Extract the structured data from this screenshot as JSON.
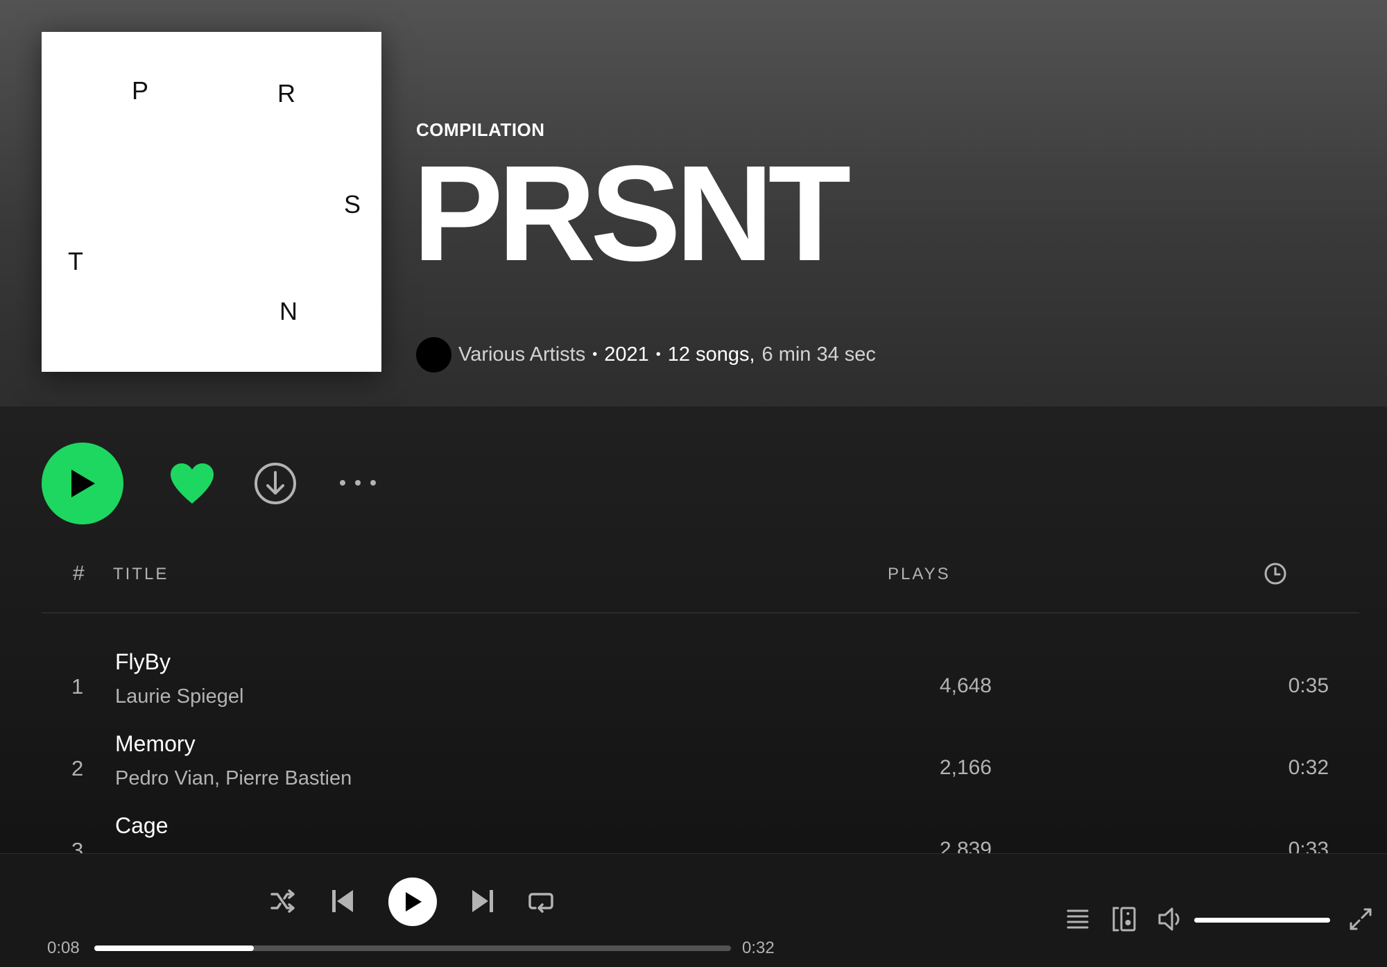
{
  "album": {
    "cover_letters": [
      "P",
      "R",
      "S",
      "T",
      "N"
    ],
    "type": "COMPILATION",
    "title": "PRSNT",
    "artist": "Various Artists",
    "year": "2021",
    "song_count": "12 songs,",
    "duration": "6 min 34 sec"
  },
  "actions": {
    "play_icon": "play-icon",
    "like_icon": "heart-icon",
    "download_icon": "download-icon",
    "more_icon": "more-icon",
    "accent_color": "#1ed760"
  },
  "table": {
    "headers": {
      "number": "#",
      "title": "TITLE",
      "plays": "PLAYS",
      "duration_icon": "clock-icon"
    },
    "rows": [
      {
        "number": "1",
        "title": "FlyBy",
        "artists": "Laurie Spiegel",
        "plays": "4,648",
        "duration": "0:35"
      },
      {
        "number": "2",
        "title": "Memory",
        "artists": "Pedro Vian, Pierre Bastien",
        "plays": "2,166",
        "duration": "0:32"
      },
      {
        "number": "3",
        "title": "Cage",
        "artists": "",
        "plays": "2,839",
        "duration": "0:33"
      }
    ]
  },
  "player": {
    "current_time": "0:08",
    "total_time": "0:32",
    "progress": 0.25,
    "volume": 1.0
  }
}
